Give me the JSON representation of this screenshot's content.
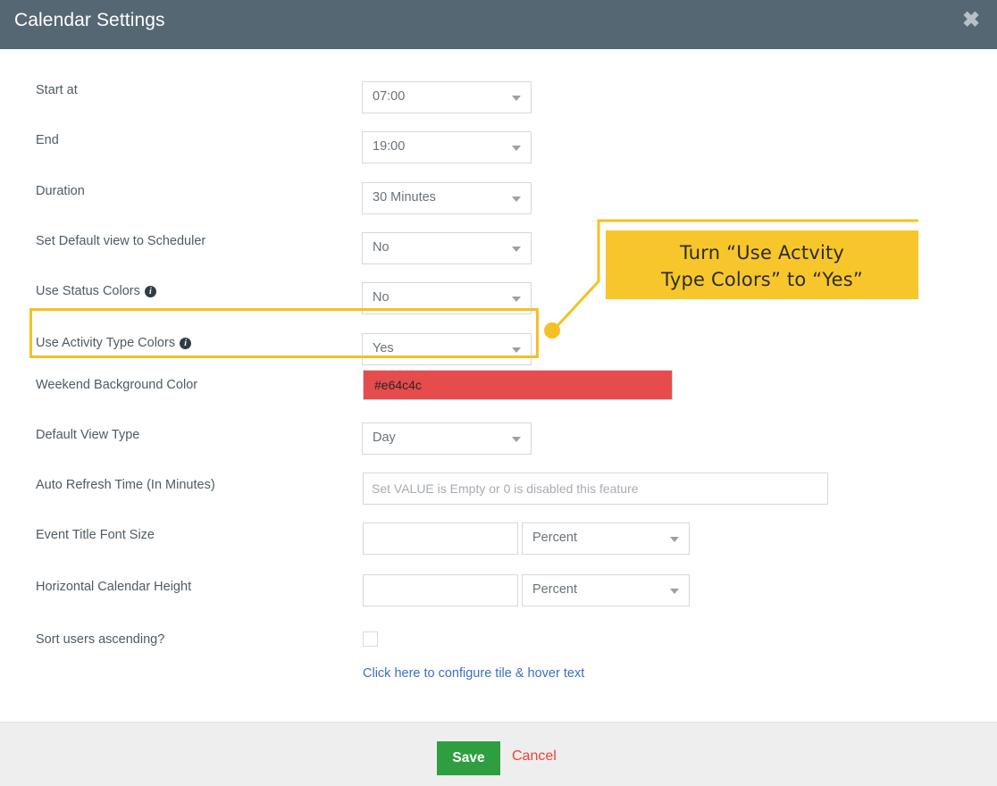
{
  "dialog": {
    "title": "Calendar Settings",
    "close_icon": "close-icon"
  },
  "form": {
    "rows": [
      {
        "label": "Start at",
        "control": "select",
        "value": "07:00"
      },
      {
        "label": "End",
        "control": "select",
        "value": "19:00"
      },
      {
        "label": "Duration",
        "control": "select",
        "value": "30 Minutes"
      },
      {
        "label": "Set Default view to Scheduler",
        "control": "select",
        "value": "No"
      },
      {
        "label": "Use Status Colors",
        "control": "select",
        "value": "No",
        "info": true
      },
      {
        "label": "Use Activity Type Colors",
        "control": "select",
        "value": "Yes",
        "info": true
      },
      {
        "label": "Weekend Background Color",
        "control": "color",
        "value": "#e64c4c"
      },
      {
        "label": "Default View Type",
        "control": "select",
        "value": "Day"
      },
      {
        "label": "Auto Refresh Time (In Minutes)",
        "control": "text",
        "value": "",
        "placeholder": "Set VALUE is Empty or 0 is disabled this feature"
      },
      {
        "label": "Event Title Font Size",
        "control": "text+select",
        "value": "",
        "unit": "Percent"
      },
      {
        "label": "Horizontal Calendar Height",
        "control": "text+select",
        "value": "",
        "unit": "Percent"
      },
      {
        "label": "Sort users ascending?",
        "control": "checkbox",
        "checked": false
      }
    ],
    "configure_link": "Click here to configure tile & hover text"
  },
  "footer": {
    "save_label": "Save",
    "cancel_label": "Cancel"
  },
  "annotation": {
    "callout_line1": "Turn “Use Actvity",
    "callout_line2": "Type Colors” to “Yes”",
    "highlight_color": "#f5c026",
    "callout_bg": "#f7c62b"
  },
  "colors": {
    "header_bg": "#566774",
    "footer_bg": "#eeeeee",
    "save_green": "#2e9e41",
    "cancel_red": "#ef4036",
    "link_blue": "#3d6fc4",
    "weekend_swatch": "#e64c4c"
  }
}
